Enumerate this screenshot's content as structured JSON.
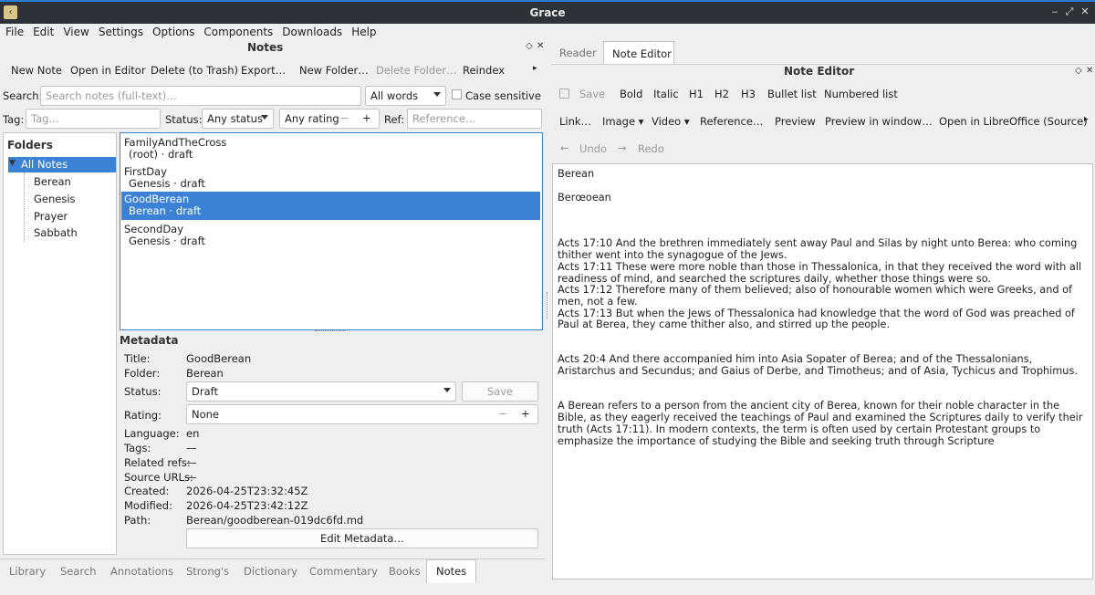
{
  "window": {
    "title": "Grace"
  },
  "menu": [
    "File",
    "Edit",
    "View",
    "Settings",
    "Options",
    "Components",
    "Downloads",
    "Help"
  ],
  "notes_panel": {
    "title": "Notes",
    "toolbar": {
      "new_note": "New Note",
      "open_in_editor": "Open in Editor",
      "delete": "Delete (to Trash)",
      "export": "Export…",
      "new_folder": "New Folder…",
      "delete_folder": "Delete Folder…",
      "reindex": "Reindex"
    },
    "search": {
      "label": "Search:",
      "placeholder": "Search notes (full-text)…",
      "mode": "All words",
      "case_sensitive": "Case sensitive"
    },
    "filters": {
      "tag_label": "Tag:",
      "tag_placeholder": "Tag…",
      "status_label": "Status:",
      "status_value": "Any status",
      "rating_value": "Any rating",
      "minus": "−",
      "plus": "+",
      "ref_label": "Ref:",
      "ref_placeholder": "Reference…"
    },
    "folders": {
      "title": "Folders",
      "root": "All Notes",
      "items": [
        "Berean",
        "Genesis",
        "Prayer",
        "Sabbath"
      ]
    },
    "notes": [
      {
        "name": "FamilyAndTheCross",
        "sub": "(root) · draft"
      },
      {
        "name": "FirstDay",
        "sub": "Genesis · draft"
      },
      {
        "name": "GoodBerean",
        "sub": "Berean · draft"
      },
      {
        "name": "SecondDay",
        "sub": "Genesis · draft"
      }
    ],
    "metadata": {
      "title": "Metadata",
      "labels": {
        "title": "Title:",
        "folder": "Folder:",
        "status": "Status:",
        "rating": "Rating:",
        "language": "Language:",
        "tags": "Tags:",
        "related": "Related refs:",
        "sources": "Source URLs:",
        "created": "Created:",
        "modified": "Modified:",
        "path": "Path:"
      },
      "values": {
        "title": "GoodBerean",
        "folder": "Berean",
        "status": "Draft",
        "rating": "None",
        "language": "en",
        "tags": "—",
        "related": "—",
        "sources": "—",
        "created": "2026-04-25T23:32:45Z",
        "modified": "2026-04-25T23:42:12Z",
        "path": "Berean/goodberean-019dc6fd.md"
      },
      "save_button": "Save Metadata",
      "edit_button": "Edit Metadata…",
      "minus": "−",
      "plus": "+"
    }
  },
  "bottom_tabs": [
    "Library",
    "Search",
    "Annotations",
    "Strong's",
    "Dictionary",
    "Commentary",
    "Books",
    "Notes"
  ],
  "right_tabs": [
    "Reader",
    "Note Editor"
  ],
  "editor": {
    "title": "Note Editor",
    "toolbar1": {
      "save": "Save",
      "bold": "Bold",
      "italic": "Italic",
      "h1": "H1",
      "h2": "H2",
      "h3": "H3",
      "bullet": "Bullet list",
      "numbered": "Numbered list"
    },
    "toolbar2": {
      "link": "Link…",
      "image": "Image ▾",
      "video": "Video ▾",
      "reference": "Reference…",
      "preview": "Preview",
      "preview_window": "Preview in window…",
      "libreoffice": "Open in LibreOffice (Source)"
    },
    "toolbar3": {
      "undo": "Undo",
      "redo": "Redo"
    },
    "content": {
      "line1": "Berean",
      "line2": "Berœoean",
      "para1": "Acts 17:10 And the brethren immediately sent away Paul and Silas by night unto Berea: who coming thither went into the synagogue of the Jews.\nActs 17:11 These were more noble than those in Thessalonica, in that they received the word with all readiness of mind, and searched the scriptures daily, whether those things were so.\nActs 17:12 Therefore many of them believed; also of honourable women which were Greeks, and of men, not a few.\nActs 17:13 But when the Jews of Thessalonica had knowledge that the word of God was preached of Paul at Berea, they came thither also, and stirred up the people.",
      "para2": "Acts 20:4 And there accompanied him into Asia Sopater of Berea; and of the Thessalonians, Aristarchus and Secundus; and Gaius of Derbe, and Timotheus; and of Asia, Tychicus and Trophimus.",
      "para3": "A Berean refers to a person from the ancient city of Berea, known for their noble character in the Bible, as they eagerly received the teachings of Paul and examined the Scriptures daily to verify their truth (Acts 17:11). In modern contexts, the term is often used by certain Protestant groups to emphasize the importance of studying the Bible and seeking truth through Scripture"
    }
  }
}
